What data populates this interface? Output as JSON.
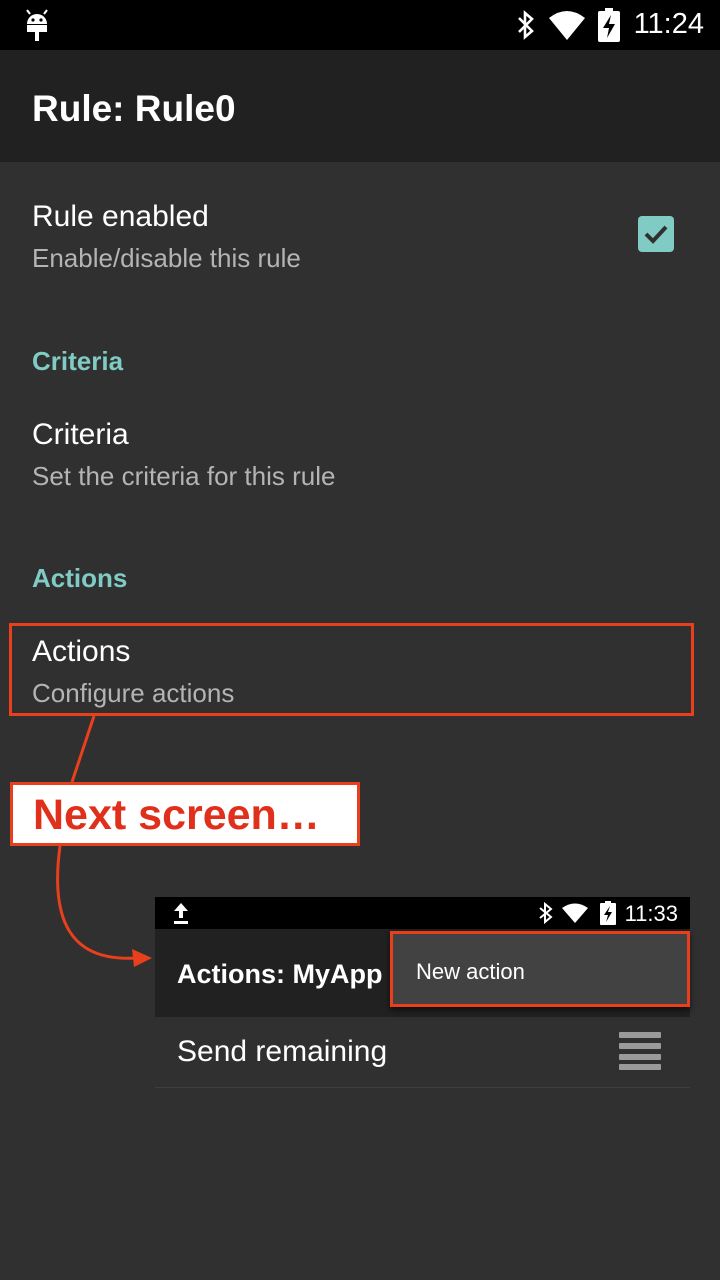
{
  "status_bar": {
    "time": "11:24"
  },
  "app_bar": {
    "title": "Rule: Rule0"
  },
  "prefs": {
    "rule_enabled": {
      "title": "Rule enabled",
      "summary": "Enable/disable this rule",
      "checked": true
    },
    "criteria_category": "Criteria",
    "criteria": {
      "title": "Criteria",
      "summary": "Set the criteria for this rule"
    },
    "actions_category": "Actions",
    "actions": {
      "title": "Actions",
      "summary": "Configure actions"
    }
  },
  "callout": {
    "text": "Next screen…"
  },
  "inset": {
    "status_time": "11:33",
    "title": "Actions: MyApp",
    "menu_item": "New action",
    "row_label": "Send remaining"
  },
  "colors": {
    "accent": "#80cbc4",
    "highlight": "#e8401c",
    "background": "#303030"
  }
}
